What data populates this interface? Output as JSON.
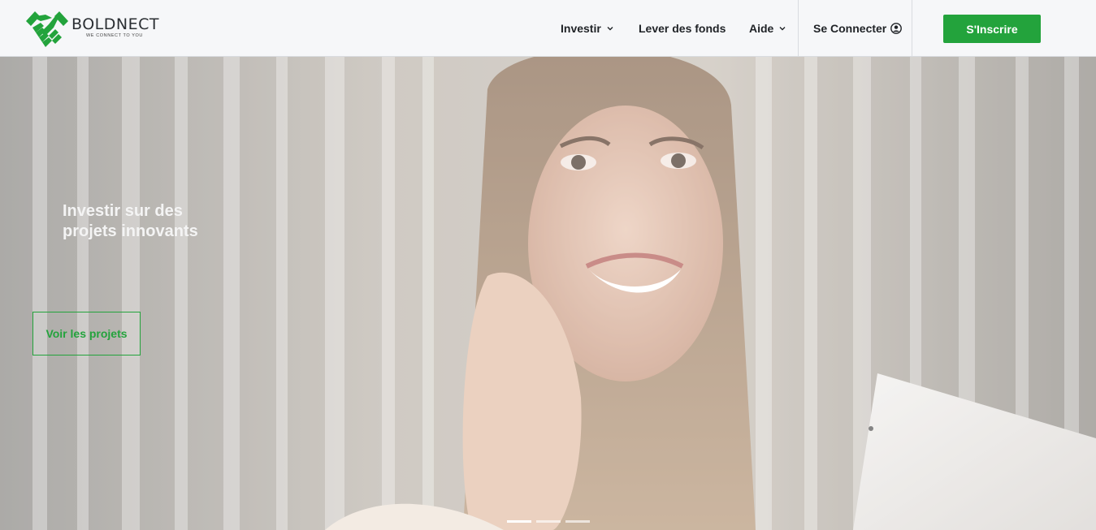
{
  "brand": {
    "name": "BOLDNECT",
    "tagline": "WE CONNECT TO YOU",
    "color": "#23a33c"
  },
  "nav": {
    "investir": "Investir",
    "lever": "Lever des fonds",
    "aide": "Aide",
    "login": "Se Connecter",
    "signup": "S'Inscrire"
  },
  "icons": {
    "dropdown": "chevron-down-icon",
    "user": "user-circle-icon",
    "logo": "handshake-icon"
  },
  "hero": {
    "title": "Investir sur des projets innovants",
    "cta": "Voir les projets",
    "slides_count": 3,
    "active_slide": 1
  }
}
